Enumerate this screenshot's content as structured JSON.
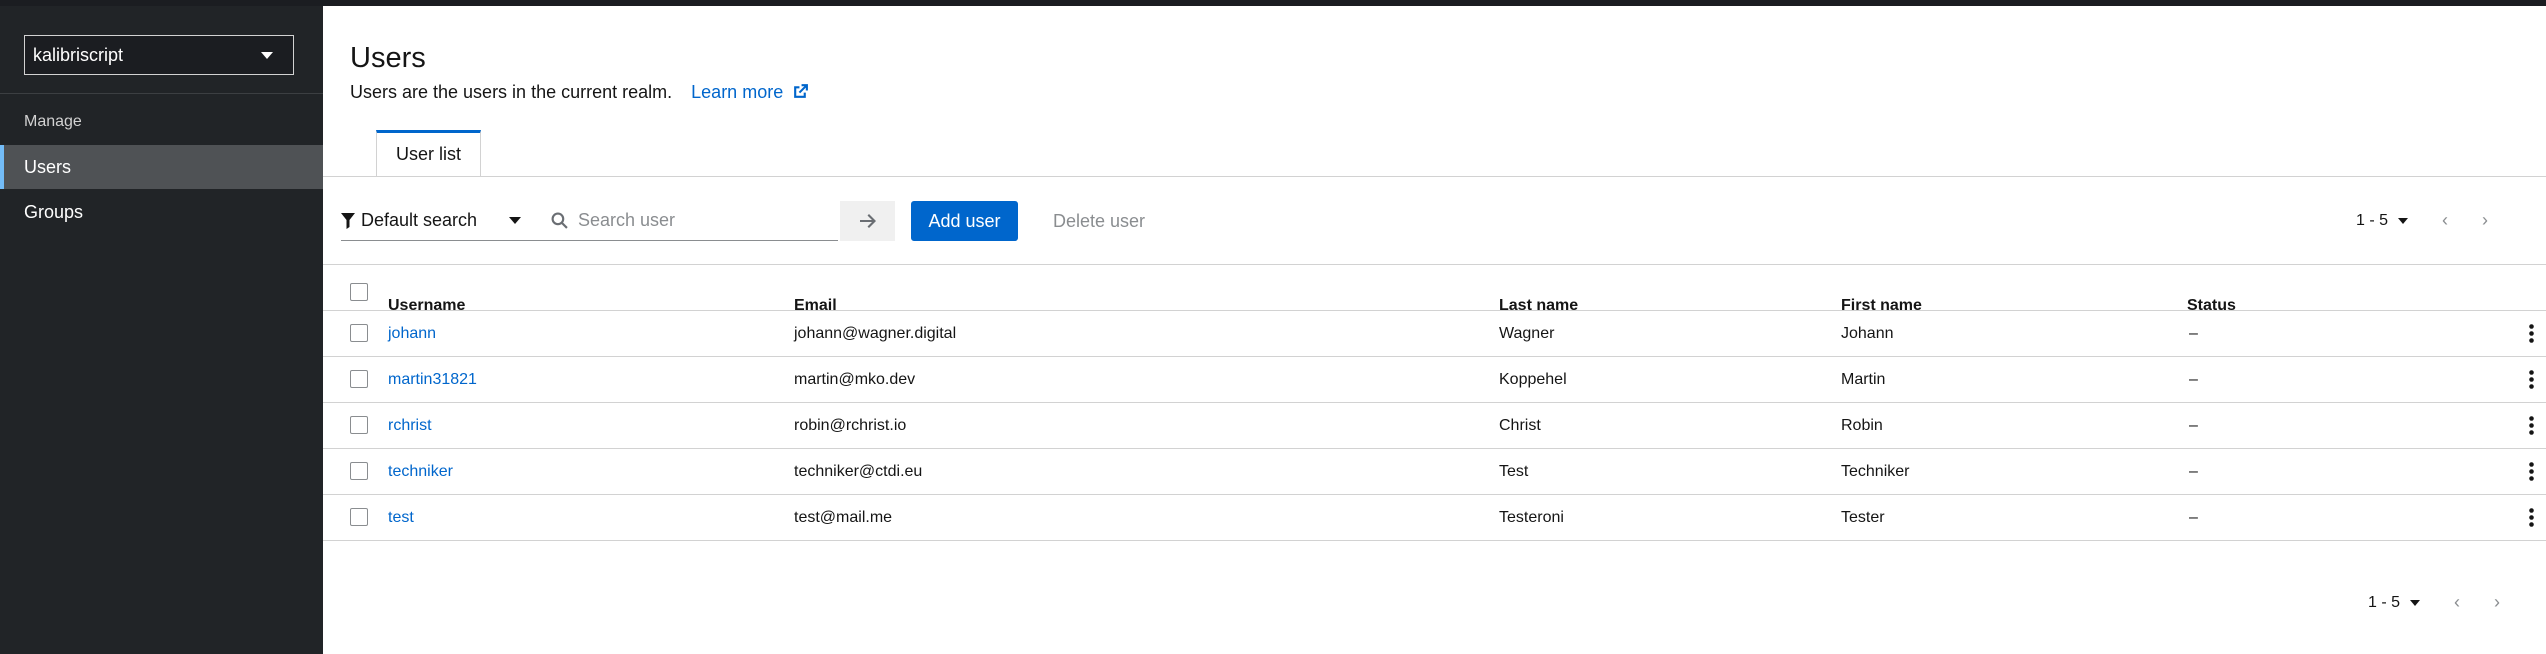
{
  "realm": {
    "selected": "kalibriscript"
  },
  "nav": {
    "section": "Manage",
    "items": [
      {
        "label": "Users",
        "active": true
      },
      {
        "label": "Groups",
        "active": false
      }
    ]
  },
  "page": {
    "title": "Users",
    "description": "Users are the users in the current realm.",
    "learn_more": "Learn more"
  },
  "tabs": [
    {
      "label": "User list"
    }
  ],
  "toolbar": {
    "filter_label": "Default search",
    "search_placeholder": "Search user",
    "add_label": "Add user",
    "delete_label": "Delete user",
    "pagination": "1 - 5"
  },
  "table": {
    "columns": {
      "username": "Username",
      "email": "Email",
      "last": "Last name",
      "first": "First name",
      "status": "Status"
    },
    "rows": [
      {
        "username": "johann",
        "email": "johann@wagner.digital",
        "last": "Wagner",
        "first": "Johann",
        "status": "–"
      },
      {
        "username": "martin31821",
        "email": "martin@mko.dev",
        "last": "Koppehel",
        "first": "Martin",
        "status": "–"
      },
      {
        "username": "rchrist",
        "email": "robin@rchrist.io",
        "last": "Christ",
        "first": "Robin",
        "status": "–"
      },
      {
        "username": "techniker",
        "email": "techniker@ctdi.eu",
        "last": "Test",
        "first": "Techniker",
        "status": "–"
      },
      {
        "username": "test",
        "email": "test@mail.me",
        "last": "Testeroni",
        "first": "Tester",
        "status": "–"
      }
    ]
  },
  "footer": {
    "pagination": "1 - 5"
  },
  "colors": {
    "accent": "#0066cc",
    "sidebar": "#212427",
    "active_nav": "#4f5255"
  }
}
